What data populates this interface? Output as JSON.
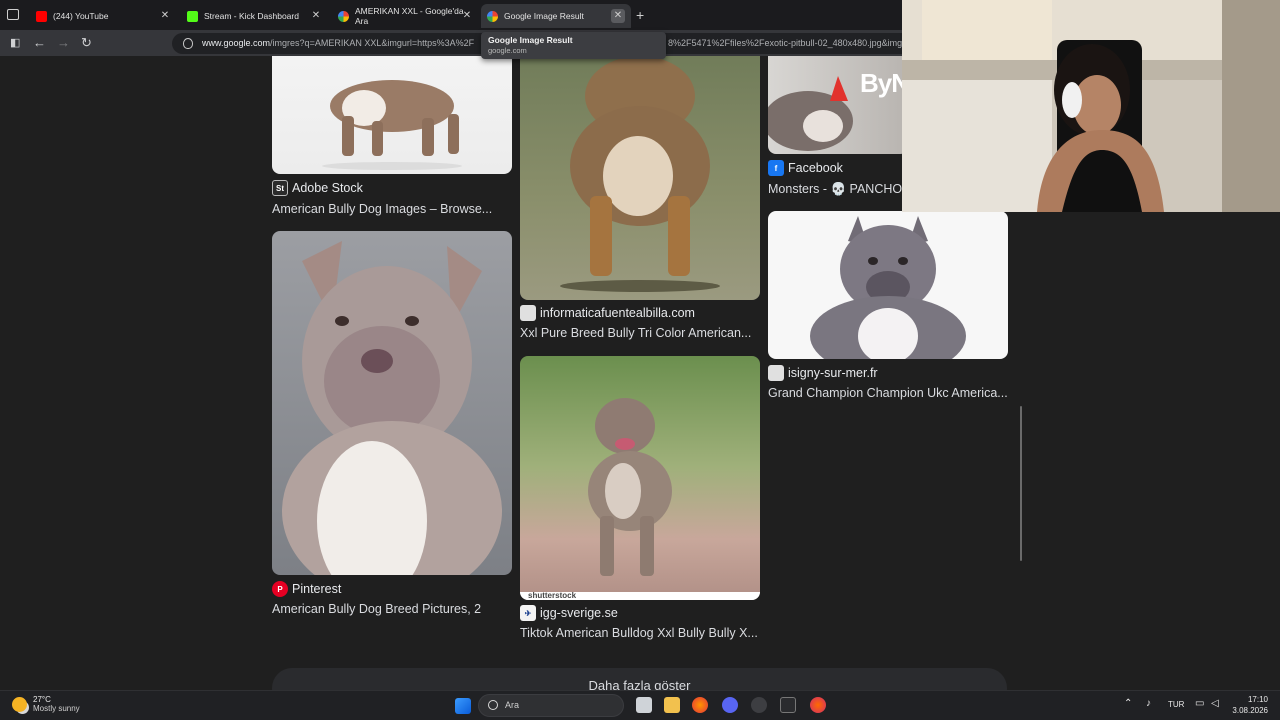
{
  "browser": {
    "tabs": [
      {
        "title": "(244) YouTube",
        "color": "#ff0000"
      },
      {
        "title": "Stream - Kick Dashboard",
        "color": "#53fc18"
      },
      {
        "title": "AMERIKAN XXL - Google'da Ara",
        "color": "#4285f4"
      },
      {
        "title": "Google Image Result",
        "color": "#4285f4"
      }
    ],
    "url_host": "www.google.com",
    "url_path": "/imgres?q=AMERIKAN XXL&imgurl=https%3A%2F",
    "url_tail": "8%2F5471%2Ffiles%2Fexotic-pitbull-02_480x480.jpg&img",
    "tooltip_title": "Google Image Result",
    "tooltip_domain": "google.com"
  },
  "results": [
    {
      "source": "Adobe Stock",
      "caption": "American Bully Dog Images – Browse...",
      "favicon": "St"
    },
    {
      "source": "Pinterest",
      "caption": "American Bully Dog Breed Pictures, 2",
      "favicon": "P"
    },
    {
      "source": "informaticafuentealbilla.com",
      "caption": "Xxl Pure Breed Bully Tri Color American...",
      "favicon": ""
    },
    {
      "source": "igg-sverige.se",
      "caption": "Tiktok American Bulldog Xxl Bully Bully X...",
      "favicon": ""
    },
    {
      "source": "Facebook",
      "caption": "Monsters - 💀 PANCHO",
      "favicon": "f"
    },
    {
      "source": "isigny-sur-mer.fr",
      "caption": "Grand Champion Champion Ukc America...",
      "favicon": ""
    }
  ],
  "more_button": "Daha fazla göster",
  "image_watermarks": {
    "facebook_logo": "ByN",
    "shutterstock": "shutterstock"
  },
  "taskbar": {
    "temperature": "27°C",
    "weather": "Mostly sunny",
    "search": "Ara",
    "language": "TUR",
    "time": "17:10",
    "date": "3.08.2026"
  }
}
